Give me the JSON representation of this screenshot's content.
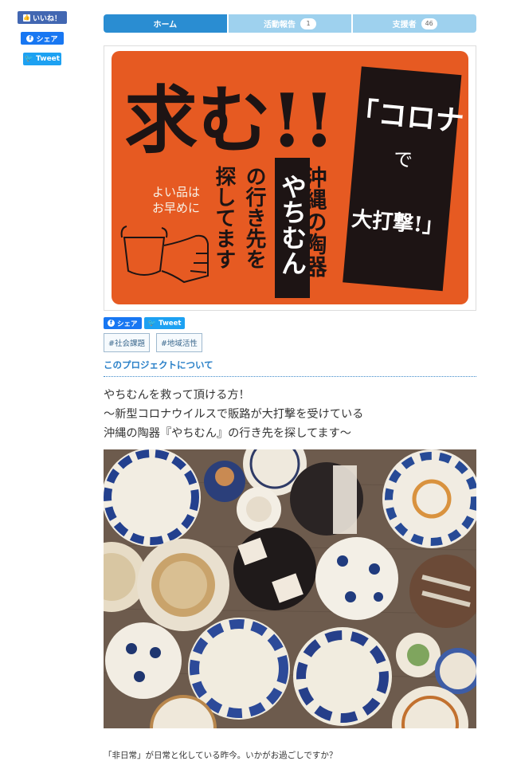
{
  "social_side": {
    "like_label": "いいね！",
    "share_label": "シェア",
    "tweet_label": "Tweet"
  },
  "tabs": [
    {
      "label": "ホーム",
      "count": null
    },
    {
      "label": "活動報告",
      "count": "1"
    },
    {
      "label": "支援者",
      "count": "46"
    }
  ],
  "hero": {
    "headline": "求む!!",
    "box_lines": [
      "「コロナ",
      "で",
      "大打撃!」"
    ],
    "col_okinawa": "沖縄の陶器",
    "col_yachimun": "やちむん",
    "col_destination": "の行き先を",
    "col_searching": "探してます",
    "handwritten_1": "よい品は",
    "handwritten_2": "お早めに",
    "colors": {
      "orange": "#e65a22",
      "dark": "#1d1414",
      "cream": "#f7f2e8"
    }
  },
  "share_row": {
    "share_label": "シェア",
    "tweet_label": "Tweet"
  },
  "tags": [
    "#社会課題",
    "#地域活性"
  ],
  "about_label": "このプロジェクトについて",
  "lead_lines": [
    "やちむんを救って頂ける方！",
    "〜新型コロナウイルスで販路が大打撃を受けている",
    "沖縄の陶器『やちむん』の行き先を探してます〜"
  ],
  "caption": "「非日常」が日常と化している昨今。いかがお過ごしですか？"
}
